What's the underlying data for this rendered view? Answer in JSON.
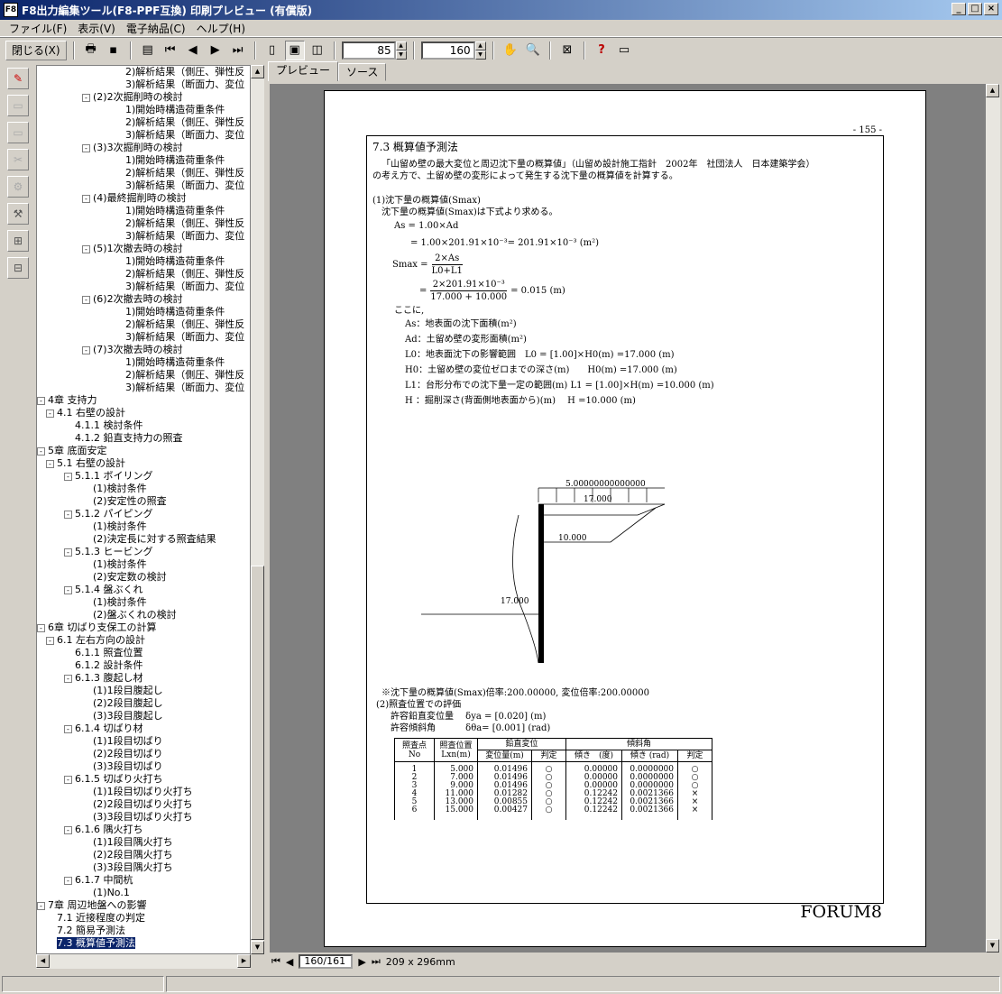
{
  "window": {
    "title": "F8出力編集ツール(F8-PPF互換) 印刷プレビュー (有償版)",
    "app_icon": "F8",
    "min": "_",
    "max": "□",
    "close": "×"
  },
  "menu": [
    "ファイル(F)",
    "表示(V)",
    "電子納品(C)",
    "ヘルプ(H)"
  ],
  "toolbar": {
    "close_label": "閉じる(X)",
    "zoom_value": "85",
    "page_value": "160"
  },
  "tree": {
    "items": [
      {
        "level": 4,
        "text": "2)解析結果（側圧、弾性反"
      },
      {
        "level": 4,
        "text": "3)解析結果（断面力、変位"
      },
      {
        "level": 3,
        "box": "-",
        "text": "(2)2次掘削時の検討"
      },
      {
        "level": 4,
        "text": "1)開始時構造荷重条件"
      },
      {
        "level": 4,
        "text": "2)解析結果（側圧、弾性反"
      },
      {
        "level": 4,
        "text": "3)解析結果（断面力、変位"
      },
      {
        "level": 3,
        "box": "-",
        "text": "(3)3次掘削時の検討"
      },
      {
        "level": 4,
        "text": "1)開始時構造荷重条件"
      },
      {
        "level": 4,
        "text": "2)解析結果（側圧、弾性反"
      },
      {
        "level": 4,
        "text": "3)解析結果（断面力、変位"
      },
      {
        "level": 3,
        "box": "-",
        "text": "(4)最終掘削時の検討"
      },
      {
        "level": 4,
        "text": "1)開始時構造荷重条件"
      },
      {
        "level": 4,
        "text": "2)解析結果（側圧、弾性反"
      },
      {
        "level": 4,
        "text": "3)解析結果（断面力、変位"
      },
      {
        "level": 3,
        "box": "-",
        "text": "(5)1次撤去時の検討"
      },
      {
        "level": 4,
        "text": "1)開始時構造荷重条件"
      },
      {
        "level": 4,
        "text": "2)解析結果（側圧、弾性反"
      },
      {
        "level": 4,
        "text": "3)解析結果（断面力、変位"
      },
      {
        "level": 3,
        "box": "-",
        "text": "(6)2次撤去時の検討"
      },
      {
        "level": 4,
        "text": "1)開始時構造荷重条件"
      },
      {
        "level": 4,
        "text": "2)解析結果（側圧、弾性反"
      },
      {
        "level": 4,
        "text": "3)解析結果（断面力、変位"
      },
      {
        "level": 3,
        "box": "-",
        "text": "(7)3次撤去時の検討"
      },
      {
        "level": 4,
        "text": "1)開始時構造荷重条件"
      },
      {
        "level": 4,
        "text": "2)解析結果（側圧、弾性反"
      },
      {
        "level": 4,
        "text": "3)解析結果（断面力、変位"
      },
      {
        "level": 0,
        "box": "-",
        "text": "4章 支持力"
      },
      {
        "level": 1,
        "box": "-",
        "text": "4.1 右壁の設計"
      },
      {
        "level": 2,
        "text": "4.1.1 検討条件"
      },
      {
        "level": 2,
        "text": "4.1.2 鉛直支持力の照査"
      },
      {
        "level": 0,
        "box": "-",
        "text": "5章 底面安定"
      },
      {
        "level": 1,
        "box": "-",
        "text": "5.1 右壁の設計"
      },
      {
        "level": 2,
        "box": "-",
        "text": "5.1.1 ボイリング"
      },
      {
        "level": 3,
        "text": "(1)検討条件"
      },
      {
        "level": 3,
        "text": "(2)安定性の照査"
      },
      {
        "level": 2,
        "box": "-",
        "text": "5.1.2 パイピング"
      },
      {
        "level": 3,
        "text": "(1)検討条件"
      },
      {
        "level": 3,
        "text": "(2)決定長に対する照査結果"
      },
      {
        "level": 2,
        "box": "-",
        "text": "5.1.3 ヒービング"
      },
      {
        "level": 3,
        "text": "(1)検討条件"
      },
      {
        "level": 3,
        "text": "(2)安定数の検討"
      },
      {
        "level": 2,
        "box": "-",
        "text": "5.1.4 盤ぶくれ"
      },
      {
        "level": 3,
        "text": "(1)検討条件"
      },
      {
        "level": 3,
        "text": "(2)盤ぶくれの検討"
      },
      {
        "level": 0,
        "box": "-",
        "text": "6章 切ばり支保工の計算"
      },
      {
        "level": 1,
        "box": "-",
        "text": "6.1 左右方向の設計"
      },
      {
        "level": 2,
        "text": "6.1.1 照査位置"
      },
      {
        "level": 2,
        "text": "6.1.2 設計条件"
      },
      {
        "level": 2,
        "box": "-",
        "text": "6.1.3 腹起し材"
      },
      {
        "level": 3,
        "text": "(1)1段目腹起し"
      },
      {
        "level": 3,
        "text": "(2)2段目腹起し"
      },
      {
        "level": 3,
        "text": "(3)3段目腹起し"
      },
      {
        "level": 2,
        "box": "-",
        "text": "6.1.4 切ばり材"
      },
      {
        "level": 3,
        "text": "(1)1段目切ばり"
      },
      {
        "level": 3,
        "text": "(2)2段目切ばり"
      },
      {
        "level": 3,
        "text": "(3)3段目切ばり"
      },
      {
        "level": 2,
        "box": "-",
        "text": "6.1.5 切ばり火打ち"
      },
      {
        "level": 3,
        "text": "(1)1段目切ばり火打ち"
      },
      {
        "level": 3,
        "text": "(2)2段目切ばり火打ち"
      },
      {
        "level": 3,
        "text": "(3)3段目切ばり火打ち"
      },
      {
        "level": 2,
        "box": "-",
        "text": "6.1.6 隅火打ち"
      },
      {
        "level": 3,
        "text": "(1)1段目隅火打ち"
      },
      {
        "level": 3,
        "text": "(2)2段目隅火打ち"
      },
      {
        "level": 3,
        "text": "(3)3段目隅火打ち"
      },
      {
        "level": 2,
        "box": "-",
        "text": "6.1.7 中間杭"
      },
      {
        "level": 3,
        "text": "(1)No.1"
      },
      {
        "level": 0,
        "box": "-",
        "text": "7章 周辺地盤への影響"
      },
      {
        "level": 1,
        "text": "7.1 近接程度の判定"
      },
      {
        "level": 1,
        "text": "7.2 簡易予測法"
      },
      {
        "level": 1,
        "text": "7.3 概算値予測法",
        "selected": true
      }
    ]
  },
  "tabs": [
    "プレビュー",
    "ソース"
  ],
  "page": {
    "page_number": "- 155 -",
    "section": "7.3 概算値予測法",
    "intro1": "「山留め壁の最大変位と周辺沈下量の概算値」（山留め設計施工指針　2002年　社団法人　日本建築学会）",
    "intro2": "の考え方で、土留め壁の変形によって発生する沈下量の概算値を計算する。",
    "s1_head": "(1)沈下量の概算値(Smax)",
    "s1_desc": "沈下量の概算値(Smax)は下式より求める。",
    "f1": "As = 1.00×Ad",
    "f2": "= 1.00×201.91×10⁻³= 201.91×10⁻³ (m²)",
    "f3_lhs": "Smax =",
    "f3_num": "2×As",
    "f3_den": "L0+L1",
    "f4_num": "2×201.91×10⁻³",
    "f4_den": "17.000 + 10.000",
    "f4_res": "= 0.015  (m)",
    "koko": "ここに,",
    "sym": [
      "As：地表面の沈下面積(m²)",
      "Ad：土留め壁の変形面積(m²)",
      "L0：地表面沈下の影響範囲　L0 = [1.00]×H0(m) =17.000 (m)",
      "H0：土留め壁の変位ゼロまでの深さ(m)　　H0(m) =17.000 (m)",
      "L1：台形分布での沈下量一定の範囲(m) L1 = [1.00]×H(m) =10.000 (m)",
      "H ：掘削深さ(背面側地表面から)(m)　 H  =10.000 (m)"
    ],
    "diagram": {
      "load_label": "5.00000000000000",
      "top_label": "17.000",
      "mid_label": "10.000",
      "depth_label": "17.000"
    },
    "ratio": "※沈下量の概算値(Smax)倍率:200.00000, 変位倍率:200.00000",
    "s2_head": "(2)照査位置での評価",
    "allow_v": "許容鉛直変位量　 δya = [0.020] (m)",
    "allow_a": "許容傾斜角　　　 δθa= [0.001] (rad)",
    "table": {
      "h_no": "照査点No",
      "h_pos": "照査位置Lxn(m)",
      "h_vert": "鉛直変位",
      "h_incl": "傾斜角",
      "h_disp": "変位量(m)",
      "h_judge": "判定",
      "h_deg": "傾き　(度)",
      "h_rad": "傾き (rad)",
      "h_judge2": "判定",
      "rows": [
        {
          "no": "1",
          "pos": "5.000",
          "disp": "0.01496",
          "j1": "○",
          "deg": "0.00000",
          "rad": "0.0000000",
          "j2": "○"
        },
        {
          "no": "2",
          "pos": "7.000",
          "disp": "0.01496",
          "j1": "○",
          "deg": "0.00000",
          "rad": "0.0000000",
          "j2": "○"
        },
        {
          "no": "3",
          "pos": "9.000",
          "disp": "0.01496",
          "j1": "○",
          "deg": "0.00000",
          "rad": "0.0000000",
          "j2": "○"
        },
        {
          "no": "4",
          "pos": "11.000",
          "disp": "0.01282",
          "j1": "○",
          "deg": "0.12242",
          "rad": "0.0021366",
          "j2": "×"
        },
        {
          "no": "5",
          "pos": "13.000",
          "disp": "0.00855",
          "j1": "○",
          "deg": "0.12242",
          "rad": "0.0021366",
          "j2": "×"
        },
        {
          "no": "6",
          "pos": "15.000",
          "disp": "0.00427",
          "j1": "○",
          "deg": "0.12242",
          "rad": "0.0021366",
          "j2": "×"
        }
      ]
    },
    "logo": "FORUM8"
  },
  "nav": {
    "page_field": "160/161",
    "paper": "209 x 296mm"
  }
}
